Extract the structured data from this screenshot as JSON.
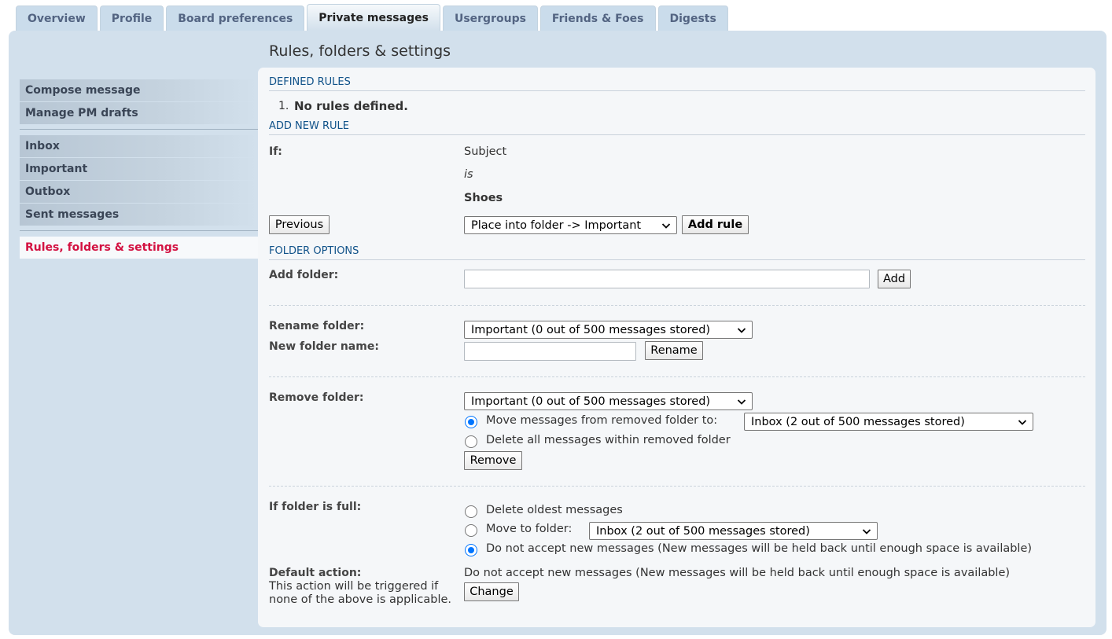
{
  "tabs": [
    "Overview",
    "Profile",
    "Board preferences",
    "Private messages",
    "Usergroups",
    "Friends & Foes",
    "Digests"
  ],
  "active_tab": "Private messages",
  "page_title": "Rules, folders & settings",
  "sidebar": {
    "group1": [
      "Compose message",
      "Manage PM drafts"
    ],
    "group2": [
      "Inbox",
      "Important",
      "Outbox",
      "Sent messages"
    ],
    "active": "Rules, folders & settings"
  },
  "defined_rules": {
    "heading": "DEFINED RULES",
    "list_number": "1.",
    "empty_text": "No rules defined."
  },
  "add_rule": {
    "heading": "ADD NEW RULE",
    "if_label": "If:",
    "field": "Subject",
    "operator": "is",
    "value": "Shoes",
    "previous_button": "Previous",
    "action_select": "Place into folder -> Important",
    "add_button": "Add rule"
  },
  "folder_options": {
    "heading": "FOLDER OPTIONS",
    "add_folder_label": "Add folder:",
    "add_folder_value": "",
    "add_button": "Add",
    "rename_label": "Rename folder:",
    "rename_select": "Important (0 out of 500 messages stored)",
    "new_name_label": "New folder name:",
    "new_name_value": "",
    "rename_button": "Rename",
    "remove_label": "Remove folder:",
    "remove_select": "Important (0 out of 500 messages stored)",
    "move_option": "Move messages from removed folder to:",
    "move_option_selected": true,
    "move_target_select": "Inbox (2 out of 500 messages stored)",
    "delete_option": "Delete all messages within removed folder",
    "remove_button": "Remove"
  },
  "full_folder": {
    "label": "If folder is full:",
    "opt_delete": "Delete oldest messages",
    "opt_move": "Move to folder:",
    "move_select": "Inbox (2 out of 500 messages stored)",
    "opt_reject": "Do not accept new messages (New messages will be held back until enough space is available)",
    "selected": "opt_reject"
  },
  "default_action": {
    "label": "Default action:",
    "explain": "This action will be triggered if none of the above is applicable.",
    "value": "Do not accept new messages (New messages will be held back until enough space is available)",
    "change_button": "Change"
  },
  "colors": {
    "panel_bg": "#d2e0ec",
    "content_bg": "#f5f7f9",
    "heading_blue": "#105289",
    "active_red": "#d31141",
    "radio_blue": "#0075ff"
  }
}
